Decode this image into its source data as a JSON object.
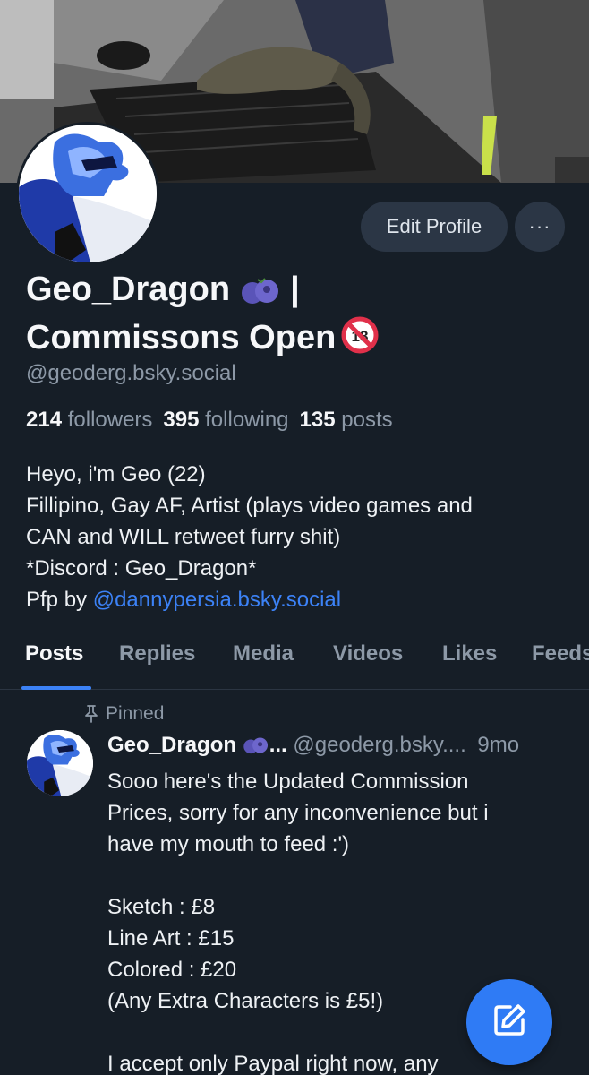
{
  "profile": {
    "edit_label": "Edit Profile",
    "more_label": "···",
    "display_name_line1": "Geo_Dragon",
    "display_name_sep": "|",
    "display_name_line2": "Commissons Open",
    "handle": "@geoderg.bsky.social",
    "followers_count": "214",
    "followers_label": "followers",
    "following_count": "395",
    "following_label": "following",
    "posts_count": "135",
    "posts_label": "posts",
    "bio": {
      "line1": "Heyo, i'm Geo (22)",
      "line2": "Fillipino, Gay AF, Artist (plays video games and",
      "line3": "CAN and WILL retweet furry shit)",
      "line4": "*Discord : Geo_Dragon*",
      "line5_prefix": "Pfp by ",
      "line5_link": "@dannypersia.bsky.social"
    }
  },
  "tabs": [
    "Posts",
    "Replies",
    "Media",
    "Videos",
    "Likes",
    "Feeds"
  ],
  "post": {
    "pinned_label": "Pinned",
    "author": "Geo_Dragon",
    "author_suffix": "...",
    "handle": "@geoderg.bsky....",
    "time": "9mo",
    "lines": [
      "Sooo here's the Updated Commission",
      "Prices, sorry for any inconvenience but i",
      "have my mouth to feed :')",
      "",
      "Sketch : £8",
      "Line Art : £15",
      "Colored : £20",
      "(Any Extra Characters is £5!)",
      "",
      "I accept only Paypal right now, any"
    ]
  },
  "colors": {
    "background": "#161e27",
    "accent": "#3c82f6",
    "button_bg": "#2b3645",
    "muted_text": "#8d99a7"
  },
  "icons": [
    "banner-image",
    "avatar-image",
    "blueberry-emoji-icon",
    "no-under-18-emoji-icon",
    "pin-icon",
    "compose-icon"
  ]
}
